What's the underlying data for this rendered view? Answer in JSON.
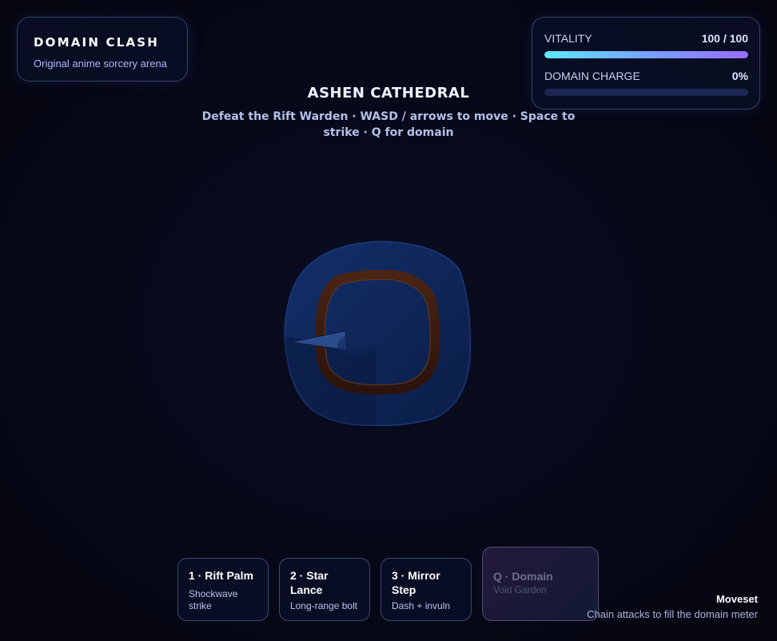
{
  "title_card": {
    "brand": "DOMAIN CLASH",
    "tagline": "Original anime sorcery arena"
  },
  "stats": {
    "vitality": {
      "label": "VITALITY",
      "value_text": "100 / 100",
      "current": 100,
      "max": 100
    },
    "domain_charge": {
      "label": "DOMAIN CHARGE",
      "value_text": "0%",
      "percent": 0
    }
  },
  "arena": {
    "name": "ASHEN CATHEDRAL",
    "instructions": "Defeat the Rift Warden · WASD / arrows to move · Space to strike · Q for domain"
  },
  "skills": [
    {
      "name": "1 · Rift Palm",
      "desc": "Shockwave strike",
      "enabled": true
    },
    {
      "name": "2 · Star Lance",
      "desc": "Long-range bolt",
      "enabled": true
    },
    {
      "name": "3 · Mirror Step",
      "desc": "Dash + invuln",
      "enabled": true
    },
    {
      "name": "Q · Domain",
      "desc": "Void Garden",
      "enabled": false
    }
  ],
  "moveset": {
    "title": "Moveset",
    "hint": "Chain attacks to fill the domain meter"
  },
  "colors": {
    "background": "#06081a",
    "bar_gradient_start": "#5ee7ff",
    "bar_gradient_end": "#9a6bff",
    "arena_floor": "#10275a",
    "ring": "#3a1d12"
  }
}
